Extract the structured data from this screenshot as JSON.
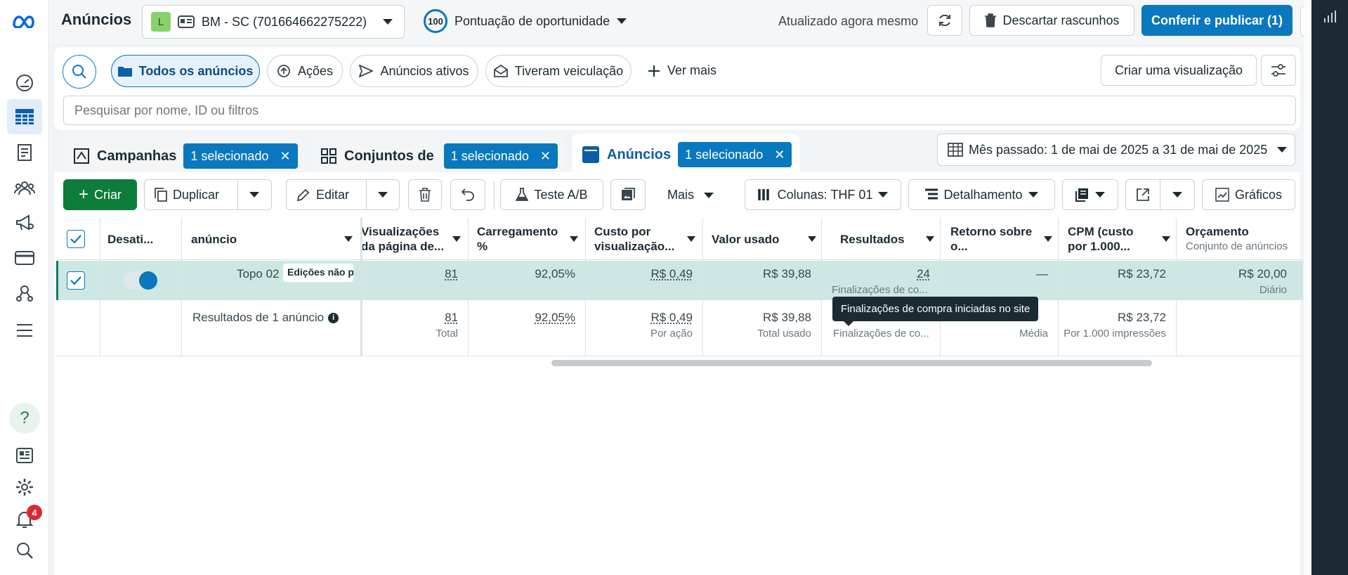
{
  "header": {
    "title": "Anúncios",
    "account_initial": "L",
    "account_name": "BM - SC (701664662275222)",
    "score": "100",
    "score_label": "Pontuação de oportunidade",
    "updated": "Atualizado agora mesmo",
    "discard": "Descartar rascunhos",
    "publish": "Conferir e publicar (1)"
  },
  "filters": {
    "all_ads": "Todos os anúncios",
    "actions": "Ações",
    "active_ads": "Anúncios ativos",
    "delivered": "Tiveram veiculação",
    "see_more": "Ver mais",
    "create_view": "Criar uma visualização",
    "search_placeholder": "Pesquisar por nome, ID ou filtros"
  },
  "tabs": {
    "campaigns": "Campanhas",
    "campaigns_badge": "1 selecionado",
    "adsets": "Conjuntos de",
    "adsets_badge": "1 selecionado",
    "ads": "Anúncios",
    "ads_badge": "1 selecionado"
  },
  "date_range": "Mês passado: 1 de mai de 2025 a 31 de mai de 2025",
  "toolbar": {
    "create": "Criar",
    "duplicate": "Duplicar",
    "edit": "Editar",
    "ab_test": "Teste A/B",
    "more": "Mais",
    "columns": "Colunas: THF 01",
    "breakdown": "Detalhamento",
    "charts": "Gráficos"
  },
  "columns": {
    "off": "Desati...",
    "ad": "anúncio",
    "views_1": "Visualizações",
    "views_2": "da página de...",
    "load_1": "Carregamento",
    "load_2": "%",
    "cpv_1": "Custo por",
    "cpv_2": "visualização...",
    "spent": "Valor usado",
    "results": "Resultados",
    "roas_1": "Retorno sobre",
    "roas_2": "o...",
    "cpm_1": "CPM (custo",
    "cpm_2": "por 1.000...",
    "budget": "Orçamento",
    "budget_sub": "Conjunto de anúncios"
  },
  "row": {
    "name": "Topo 02",
    "edit_tag": "Edições não p",
    "views": "81",
    "load": "92,05%",
    "cpv": "R$ 0,49",
    "spent": "R$ 39,88",
    "results": "24",
    "results_sub": "Finalizações de co...",
    "roas": "—",
    "cpm": "R$ 23,72",
    "budget": "R$ 20,00",
    "budget_sub": "Diário"
  },
  "total": {
    "label": "Resultados de 1 anúncio",
    "views": "81",
    "views_sub": "Total",
    "load": "92,05%",
    "cpv": "R$ 0,49",
    "cpv_sub": "Por ação",
    "spent": "R$ 39,88",
    "spent_sub": "Total usado",
    "results_sub": "Finalizações de co...",
    "roas_sub": "Média",
    "cpm": "R$ 23,72",
    "cpm_sub": "Por 1.000 impressões"
  },
  "tooltip": "Finalizações de compra iniciadas no site",
  "notifications": "4"
}
